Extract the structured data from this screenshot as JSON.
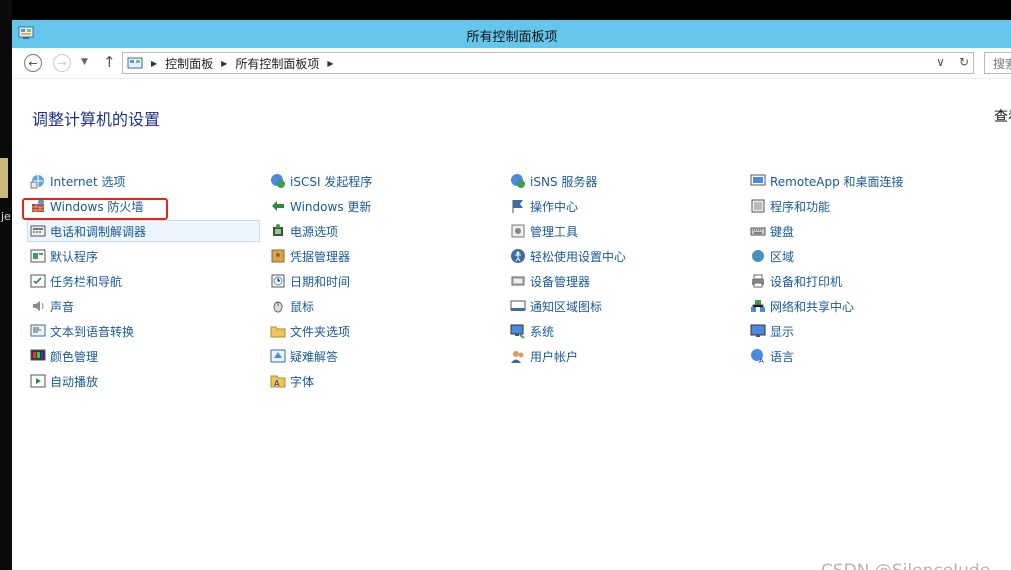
{
  "window": {
    "title": "所有控制面板项"
  },
  "address": {
    "crumbs": [
      "控制面板",
      "所有控制面板项"
    ],
    "search_placeholder": "搜索"
  },
  "page": {
    "heading": "调整计算机的设置",
    "view_by": "查看"
  },
  "columns": [
    [
      {
        "label": "Internet 选项",
        "icon": "internet-options-icon"
      },
      {
        "label": "Windows 防火墙",
        "icon": "windows-firewall-icon"
      },
      {
        "label": "电话和调制解调器",
        "icon": "phone-modem-icon"
      },
      {
        "label": "默认程序",
        "icon": "default-programs-icon"
      },
      {
        "label": "任务栏和导航",
        "icon": "taskbar-icon"
      },
      {
        "label": "声音",
        "icon": "sound-icon"
      },
      {
        "label": "文本到语音转换",
        "icon": "text-to-speech-icon"
      },
      {
        "label": "颜色管理",
        "icon": "color-management-icon"
      },
      {
        "label": "自动播放",
        "icon": "autoplay-icon"
      }
    ],
    [
      {
        "label": "iSCSI 发起程序",
        "icon": "iscsi-icon"
      },
      {
        "label": "Windows 更新",
        "icon": "windows-update-icon"
      },
      {
        "label": "电源选项",
        "icon": "power-options-icon"
      },
      {
        "label": "凭据管理器",
        "icon": "credential-manager-icon"
      },
      {
        "label": "日期和时间",
        "icon": "date-time-icon"
      },
      {
        "label": "鼠标",
        "icon": "mouse-icon"
      },
      {
        "label": "文件夹选项",
        "icon": "folder-options-icon"
      },
      {
        "label": "疑难解答",
        "icon": "troubleshooting-icon"
      },
      {
        "label": "字体",
        "icon": "fonts-icon"
      }
    ],
    [
      {
        "label": "iSNS 服务器",
        "icon": "isns-icon"
      },
      {
        "label": "操作中心",
        "icon": "action-center-icon"
      },
      {
        "label": "管理工具",
        "icon": "admin-tools-icon"
      },
      {
        "label": "轻松使用设置中心",
        "icon": "ease-of-access-icon"
      },
      {
        "label": "设备管理器",
        "icon": "device-manager-icon"
      },
      {
        "label": "通知区域图标",
        "icon": "notification-icons-icon"
      },
      {
        "label": "系统",
        "icon": "system-icon"
      },
      {
        "label": "用户帐户",
        "icon": "user-accounts-icon"
      }
    ],
    [
      {
        "label": "RemoteApp 和桌面连接",
        "icon": "remoteapp-icon"
      },
      {
        "label": "程序和功能",
        "icon": "programs-features-icon"
      },
      {
        "label": "键盘",
        "icon": "keyboard-icon"
      },
      {
        "label": "区域",
        "icon": "region-icon"
      },
      {
        "label": "设备和打印机",
        "icon": "devices-printers-icon"
      },
      {
        "label": "网络和共享中心",
        "icon": "network-sharing-icon"
      },
      {
        "label": "显示",
        "icon": "display-icon"
      },
      {
        "label": "语言",
        "icon": "language-icon"
      }
    ]
  ],
  "colors": {
    "titlebar": "#63c6ea",
    "link": "#1a5a96",
    "heading": "#1e3287",
    "annotation": "#e0281d"
  },
  "watermark": "CSDN @SilenceJude",
  "desktop_letter": "je"
}
